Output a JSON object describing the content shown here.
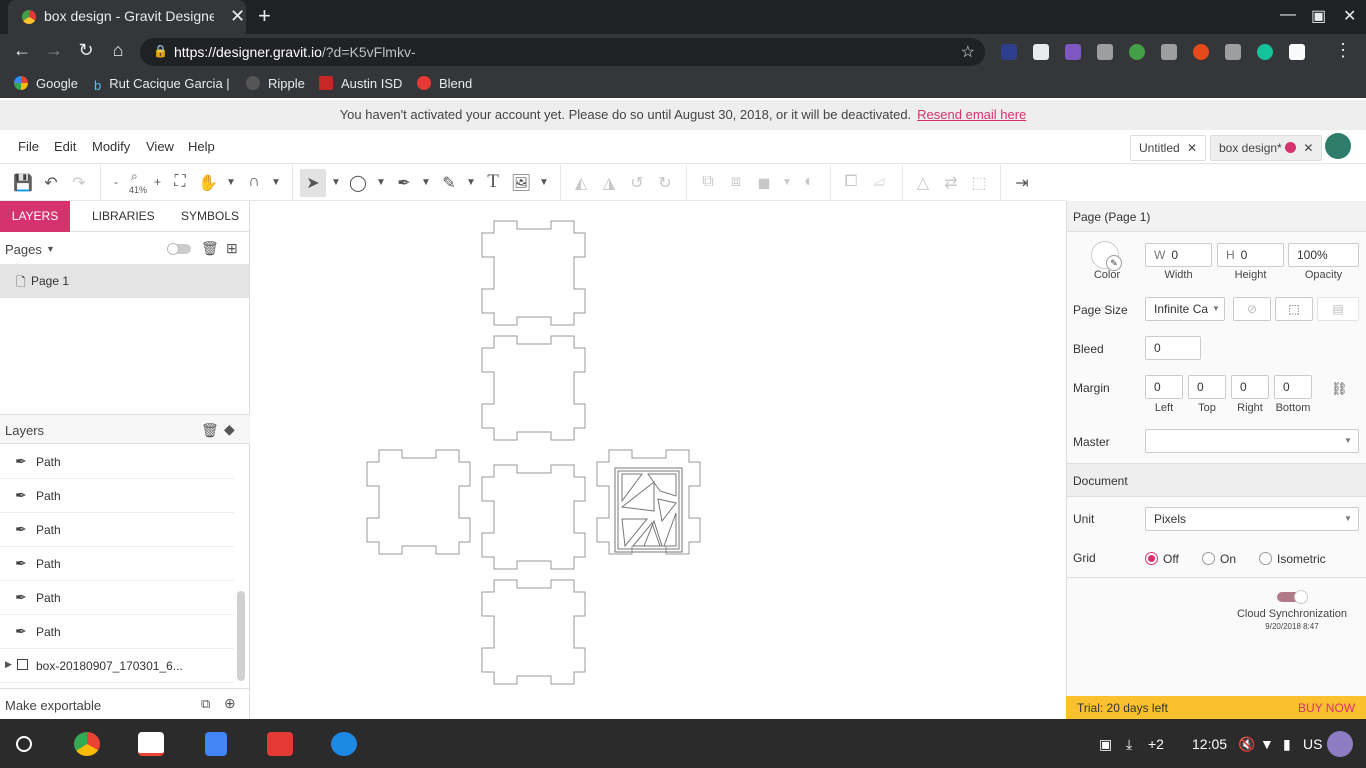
{
  "browser": {
    "tab_title": "box design - Gravit Designer",
    "tab_close": "✕",
    "new_tab": "+",
    "url_host": "https://designer.gravit.io",
    "url_path": "/?d=K5vFlmkv-",
    "bookmarks": [
      "Google",
      "Rut Cacique Garcia |",
      "Ripple",
      "Austin ISD",
      "Blend"
    ]
  },
  "notice": {
    "text": "You haven't activated your account yet. Please do so until August 30, 2018, or it will be deactivated.",
    "link": "Resend email here"
  },
  "menu": {
    "items": [
      "File",
      "Edit",
      "Modify",
      "View",
      "Help"
    ],
    "doc_tabs": [
      "Untitled",
      "box design*"
    ]
  },
  "toolbar": {
    "zoom": "41%",
    "zoom_minus": "-",
    "zoom_plus": "+"
  },
  "left_panel": {
    "tabs": [
      "LAYERS",
      "LIBRARIES",
      "SYMBOLS"
    ],
    "pages_label": "Pages",
    "page_item": "Page 1",
    "layers_label": "Layers",
    "layers": [
      "Path",
      "Path",
      "Path",
      "Path",
      "Path",
      "Path",
      "box-20180907_170301_6..."
    ],
    "make_exportable": "Make exportable"
  },
  "right_panel": {
    "title": "Page (Page 1)",
    "color_label": "Color",
    "w_prefix": "W",
    "w_value": "0",
    "width_label": "Width",
    "h_prefix": "H",
    "h_value": "0",
    "height_label": "Height",
    "opacity_value": "100%",
    "opacity_label": "Opacity",
    "page_size_label": "Page Size",
    "page_size_value": "Infinite Ca",
    "bleed_label": "Bleed",
    "bleed_value": "0",
    "margin_label": "Margin",
    "margins": [
      {
        "value": "0",
        "label": "Left"
      },
      {
        "value": "0",
        "label": "Top"
      },
      {
        "value": "0",
        "label": "Right"
      },
      {
        "value": "0",
        "label": "Bottom"
      }
    ],
    "master_label": "Master",
    "document_label": "Document",
    "unit_label": "Unit",
    "unit_value": "Pixels",
    "grid_label": "Grid",
    "grid_options": [
      "Off",
      "On",
      "Isometric"
    ],
    "grid_selected": "Off",
    "cloud_sync_label": "Cloud Synchronization",
    "cloud_sync_time": "9/20/2018 8:47",
    "trial_text": "Trial: 20 days left",
    "buy_now": "BUY NOW"
  },
  "shelf": {
    "notif_count": "+2",
    "time": "12:05",
    "locale": "US"
  },
  "colors": {
    "accent": "#d6336c",
    "trial_bar": "#fbc02d",
    "chrome_dark": "#35363a"
  }
}
